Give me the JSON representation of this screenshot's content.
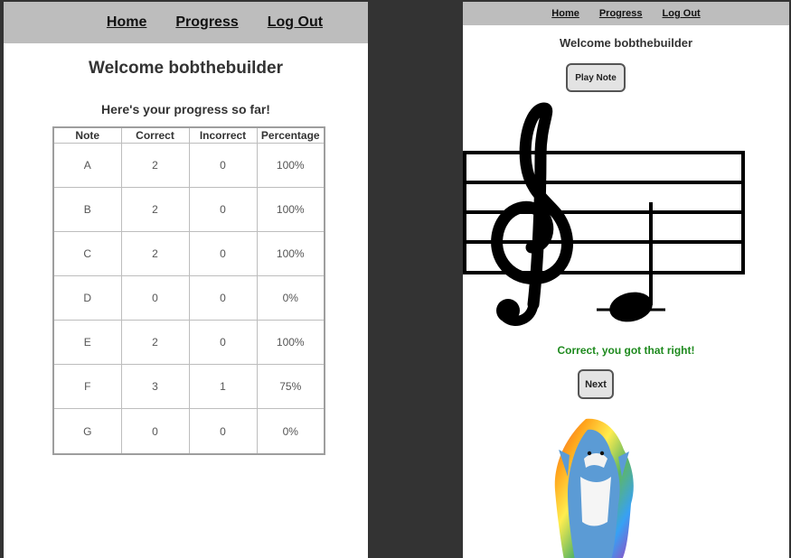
{
  "left_screen": {
    "nav": {
      "home": "Home",
      "progress": "Progress",
      "logout": "Log Out"
    },
    "welcome": "Welcome bobthebuilder",
    "subtitle": "Here's your progress so far!",
    "table": {
      "headers": [
        "Note",
        "Correct",
        "Incorrect",
        "Percentage"
      ],
      "rows": [
        {
          "note": "A",
          "correct": "2",
          "incorrect": "0",
          "percentage": "100%",
          "status": "good"
        },
        {
          "note": "B",
          "correct": "2",
          "incorrect": "0",
          "percentage": "100%",
          "status": "good"
        },
        {
          "note": "C",
          "correct": "2",
          "incorrect": "0",
          "percentage": "100%",
          "status": "good"
        },
        {
          "note": "D",
          "correct": "0",
          "incorrect": "0",
          "percentage": "0%",
          "status": "bad"
        },
        {
          "note": "E",
          "correct": "2",
          "incorrect": "0",
          "percentage": "100%",
          "status": "good"
        },
        {
          "note": "F",
          "correct": "3",
          "incorrect": "1",
          "percentage": "75%",
          "status": "good"
        },
        {
          "note": "G",
          "correct": "0",
          "incorrect": "0",
          "percentage": "0%",
          "status": "bad"
        }
      ]
    }
  },
  "right_screen": {
    "nav": {
      "home": "Home",
      "progress": "Progress",
      "logout": "Log Out"
    },
    "welcome": "Welcome bobthebuilder",
    "play_note_label": "Play Note",
    "staff_icon": "treble-clef-staff-icon",
    "note_icon": "quarter-note-icon",
    "result_message": "Correct, you got that right!",
    "next_label": "Next",
    "mascot_icon": "dancing-shark-icon"
  },
  "colors": {
    "navbar": "#bdbdbd",
    "percent_good": "#2e8b3a",
    "percent_bad": "#e53935",
    "correct_message": "#1e8a1e",
    "desktop": "#333333"
  }
}
